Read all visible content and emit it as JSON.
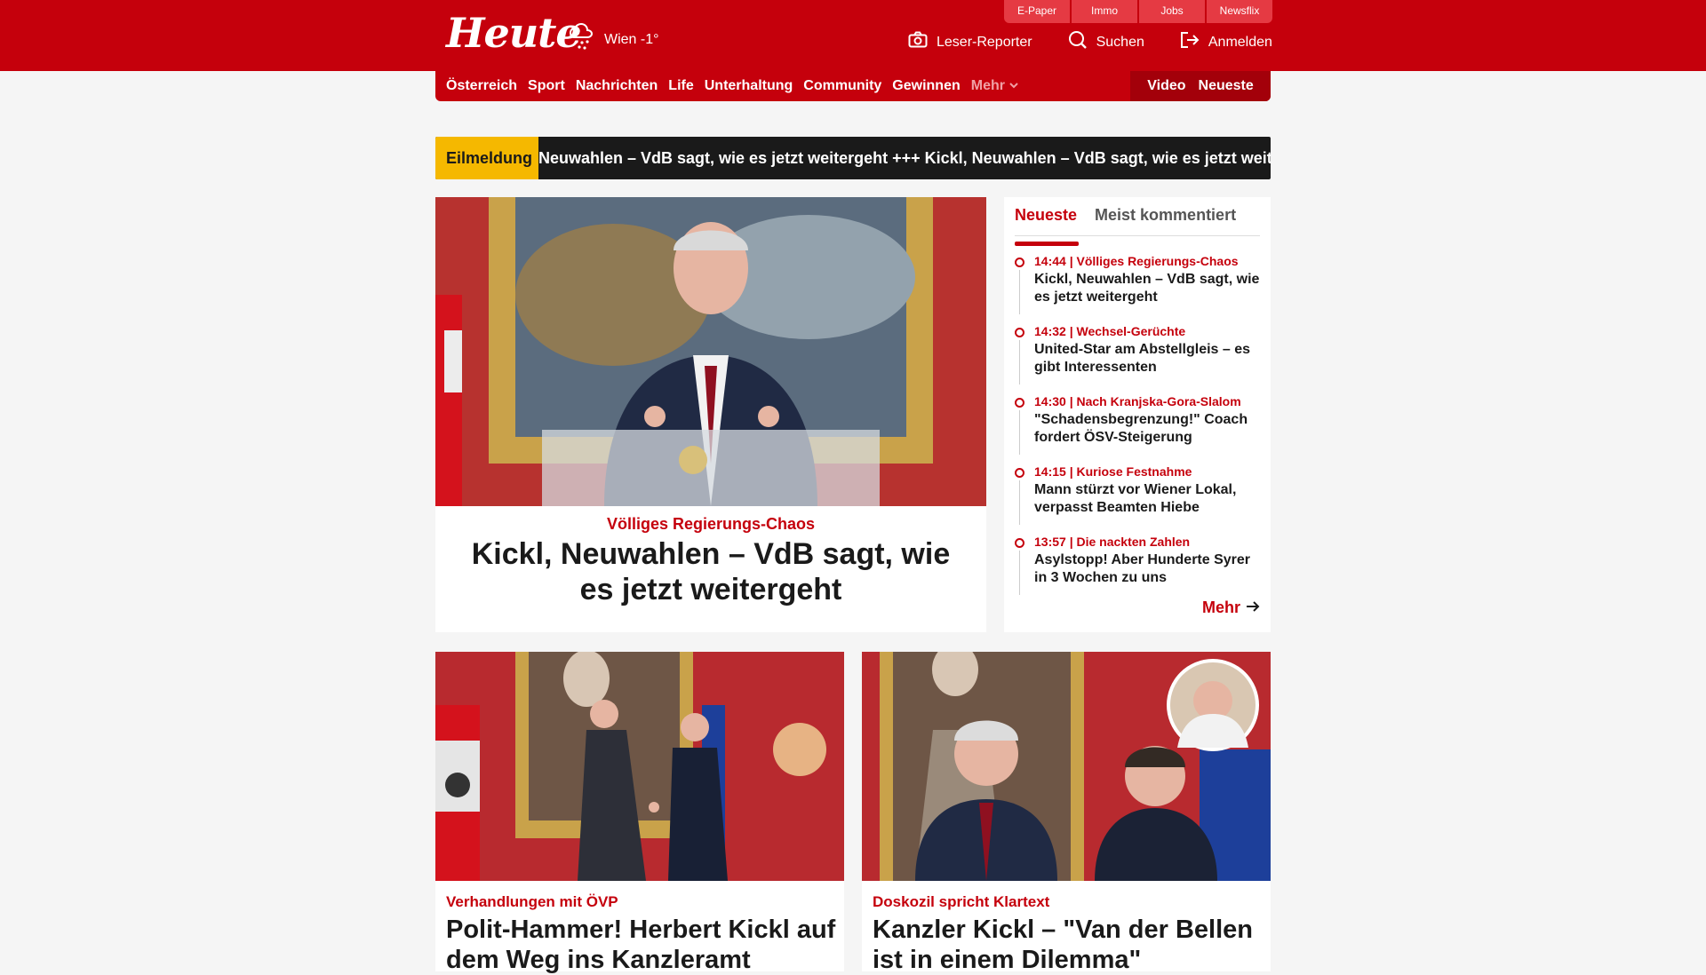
{
  "brand": {
    "logo": "Heute",
    "weather": "Wien -1°",
    "accent": "#c5000c"
  },
  "services": [
    "E-Paper",
    "Immo",
    "Jobs",
    "Newsflix"
  ],
  "actions": {
    "reporter": "Leser-Reporter",
    "search": "Suchen",
    "login": "Anmelden"
  },
  "nav": {
    "items": [
      "Österreich",
      "Sport",
      "Nachrichten",
      "Life",
      "Unterhaltung",
      "Community",
      "Gewinnen"
    ],
    "more": "Mehr",
    "video": "Video",
    "latest": "Neueste"
  },
  "breaking": {
    "label": "Eilmeldung",
    "text": "Neuwahlen – VdB sagt, wie es jetzt weitergeht  +++  Kickl, Neuwahlen – VdB sagt, wie es jetzt weitergeht"
  },
  "hero": {
    "kicker": "Völliges Regierungs-Chaos",
    "headline": "Kickl, Neuwahlen – VdB sagt, wie es jetzt weitergeht"
  },
  "sidebar": {
    "tabs": [
      "Neueste",
      "Meist kommentiert"
    ],
    "items": [
      {
        "meta": "14:44 | Völliges Regierungs-Chaos",
        "title": "Kickl, Neuwahlen – VdB sagt, wie es jetzt weitergeht"
      },
      {
        "meta": "14:32 | Wechsel-Gerüchte",
        "title": "United-Star am Abstellgleis – es gibt Interessenten"
      },
      {
        "meta": "14:30 | Nach Kranjska-Gora-Slalom",
        "title": "\"Schadensbegrenzung!\" Coach fordert ÖSV-Steigerung"
      },
      {
        "meta": "14:15 | Kuriose Festnahme",
        "title": "Mann stürzt vor Wiener Lokal, verpasst Beamten Hiebe"
      },
      {
        "meta": "13:57 | Die nackten Zahlen",
        "title": "Asylstopp! Aber Hunderte Syrer in 3 Wochen zu uns"
      }
    ],
    "more": "Mehr"
  },
  "cards": [
    {
      "kicker": "Verhandlungen mit ÖVP",
      "headline": "Polit-Hammer! Herbert Kickl auf dem Weg ins Kanzleramt"
    },
    {
      "kicker": "Doskozil spricht Klartext",
      "headline": "Kanzler Kickl – \"Van der Bellen ist in einem Dilemma\""
    }
  ]
}
